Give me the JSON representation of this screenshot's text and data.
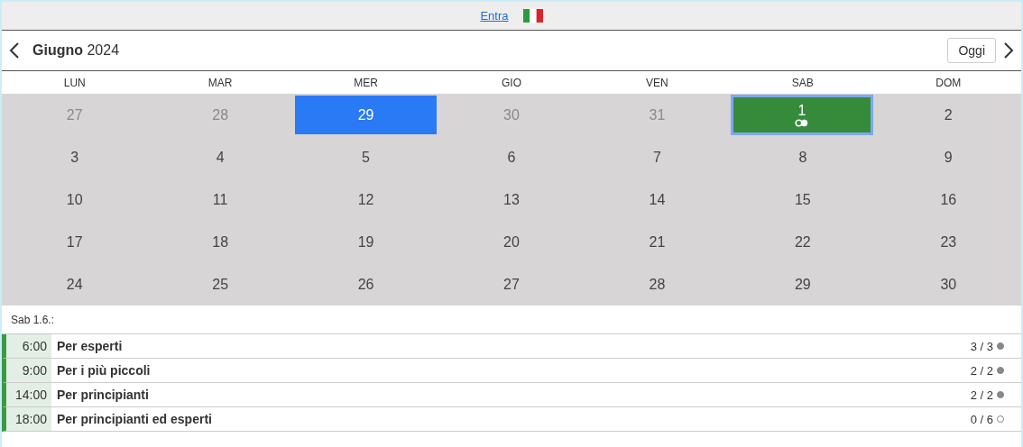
{
  "topbar": {
    "login_link": "Entra"
  },
  "header": {
    "month": "Giugno",
    "year": "2024",
    "today_button": "Oggi"
  },
  "weekdays": [
    "LUN",
    "MAR",
    "MER",
    "GIO",
    "VEN",
    "SAB",
    "DOM"
  ],
  "weeks": [
    [
      {
        "day": "27",
        "outside": true,
        "today": false,
        "selected": false,
        "has_events": false
      },
      {
        "day": "28",
        "outside": true,
        "today": false,
        "selected": false,
        "has_events": false
      },
      {
        "day": "29",
        "outside": true,
        "today": true,
        "selected": false,
        "has_events": false
      },
      {
        "day": "30",
        "outside": true,
        "today": false,
        "selected": false,
        "has_events": false
      },
      {
        "day": "31",
        "outside": true,
        "today": false,
        "selected": false,
        "has_events": false
      },
      {
        "day": "1",
        "outside": false,
        "today": false,
        "selected": true,
        "has_events": true
      },
      {
        "day": "2",
        "outside": false,
        "today": false,
        "selected": false,
        "has_events": false
      }
    ],
    [
      {
        "day": "3",
        "outside": false,
        "today": false,
        "selected": false,
        "has_events": false
      },
      {
        "day": "4",
        "outside": false,
        "today": false,
        "selected": false,
        "has_events": false
      },
      {
        "day": "5",
        "outside": false,
        "today": false,
        "selected": false,
        "has_events": false
      },
      {
        "day": "6",
        "outside": false,
        "today": false,
        "selected": false,
        "has_events": false
      },
      {
        "day": "7",
        "outside": false,
        "today": false,
        "selected": false,
        "has_events": false
      },
      {
        "day": "8",
        "outside": false,
        "today": false,
        "selected": false,
        "has_events": false
      },
      {
        "day": "9",
        "outside": false,
        "today": false,
        "selected": false,
        "has_events": false
      }
    ],
    [
      {
        "day": "10",
        "outside": false,
        "today": false,
        "selected": false,
        "has_events": false
      },
      {
        "day": "11",
        "outside": false,
        "today": false,
        "selected": false,
        "has_events": false
      },
      {
        "day": "12",
        "outside": false,
        "today": false,
        "selected": false,
        "has_events": false
      },
      {
        "day": "13",
        "outside": false,
        "today": false,
        "selected": false,
        "has_events": false
      },
      {
        "day": "14",
        "outside": false,
        "today": false,
        "selected": false,
        "has_events": false
      },
      {
        "day": "15",
        "outside": false,
        "today": false,
        "selected": false,
        "has_events": false
      },
      {
        "day": "16",
        "outside": false,
        "today": false,
        "selected": false,
        "has_events": false
      }
    ],
    [
      {
        "day": "17",
        "outside": false,
        "today": false,
        "selected": false,
        "has_events": false
      },
      {
        "day": "18",
        "outside": false,
        "today": false,
        "selected": false,
        "has_events": false
      },
      {
        "day": "19",
        "outside": false,
        "today": false,
        "selected": false,
        "has_events": false
      },
      {
        "day": "20",
        "outside": false,
        "today": false,
        "selected": false,
        "has_events": false
      },
      {
        "day": "21",
        "outside": false,
        "today": false,
        "selected": false,
        "has_events": false
      },
      {
        "day": "22",
        "outside": false,
        "today": false,
        "selected": false,
        "has_events": false
      },
      {
        "day": "23",
        "outside": false,
        "today": false,
        "selected": false,
        "has_events": false
      }
    ],
    [
      {
        "day": "24",
        "outside": false,
        "today": false,
        "selected": false,
        "has_events": false
      },
      {
        "day": "25",
        "outside": false,
        "today": false,
        "selected": false,
        "has_events": false
      },
      {
        "day": "26",
        "outside": false,
        "today": false,
        "selected": false,
        "has_events": false
      },
      {
        "day": "27",
        "outside": false,
        "today": false,
        "selected": false,
        "has_events": false
      },
      {
        "day": "28",
        "outside": false,
        "today": false,
        "selected": false,
        "has_events": false
      },
      {
        "day": "29",
        "outside": false,
        "today": false,
        "selected": false,
        "has_events": false
      },
      {
        "day": "30",
        "outside": false,
        "today": false,
        "selected": false,
        "has_events": false
      }
    ]
  ],
  "day_caption": "Sab 1.6.:",
  "events": [
    {
      "time": "6:00",
      "title": "Per esperti",
      "count": "3 / 3",
      "full": true
    },
    {
      "time": "9:00",
      "title": "Per i più piccoli",
      "count": "2 / 2",
      "full": true
    },
    {
      "time": "14:00",
      "title": "Per principianti",
      "count": "2 / 2",
      "full": true
    },
    {
      "time": "18:00",
      "title": "Per principianti ed esperti",
      "count": "0 / 6",
      "full": false
    }
  ]
}
